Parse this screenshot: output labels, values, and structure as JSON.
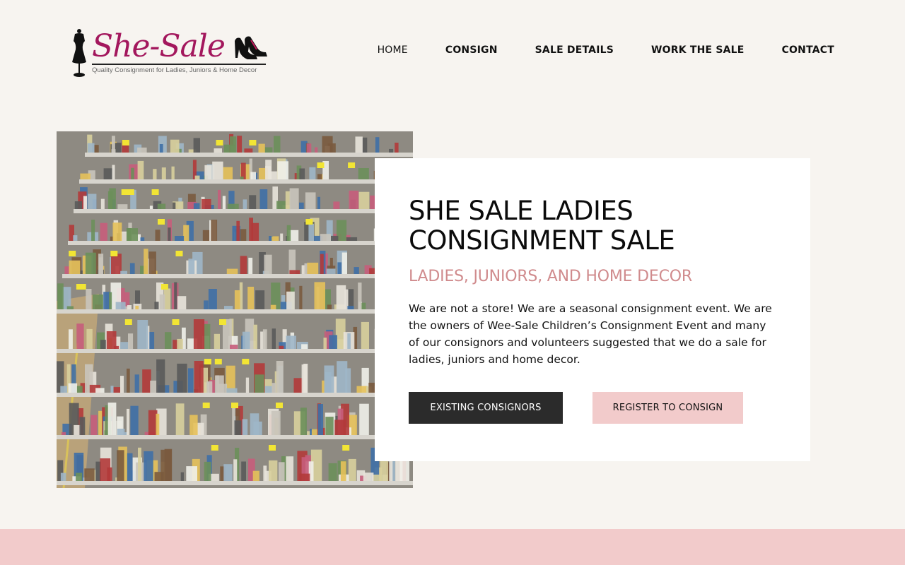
{
  "brand": {
    "name": "She-Sale",
    "tagline": "Quality Consignment for Ladies, Juniors & Home Decor"
  },
  "nav": {
    "items": [
      {
        "label": "HOME",
        "active": true
      },
      {
        "label": "CONSIGN"
      },
      {
        "label": "SALE DETAILS"
      },
      {
        "label": "WORK THE SALE"
      },
      {
        "label": "CONTACT"
      }
    ]
  },
  "hero": {
    "title": "SHE SALE LADIES CONSIGNMENT SALE",
    "subtitle": "LADIES, JUNIORS, AND HOME DECOR",
    "body": "We are not a store! We are a seasonal consignment event. We are the owners of Wee-Sale Children’s Consignment Event and many of our consignors and volunteers suggested that we do a sale for ladies, juniors and home decor.",
    "buttons": {
      "existing": "EXISTING CONSIGNORS",
      "register": "REGISTER TO CONSIGN"
    }
  },
  "colors": {
    "background": "#f7f4f0",
    "brand_magenta": "#a3175d",
    "accent_pink": "#f2cbcb",
    "subtitle_rose": "#d08b8d",
    "dark_button": "#2b2b2b"
  }
}
